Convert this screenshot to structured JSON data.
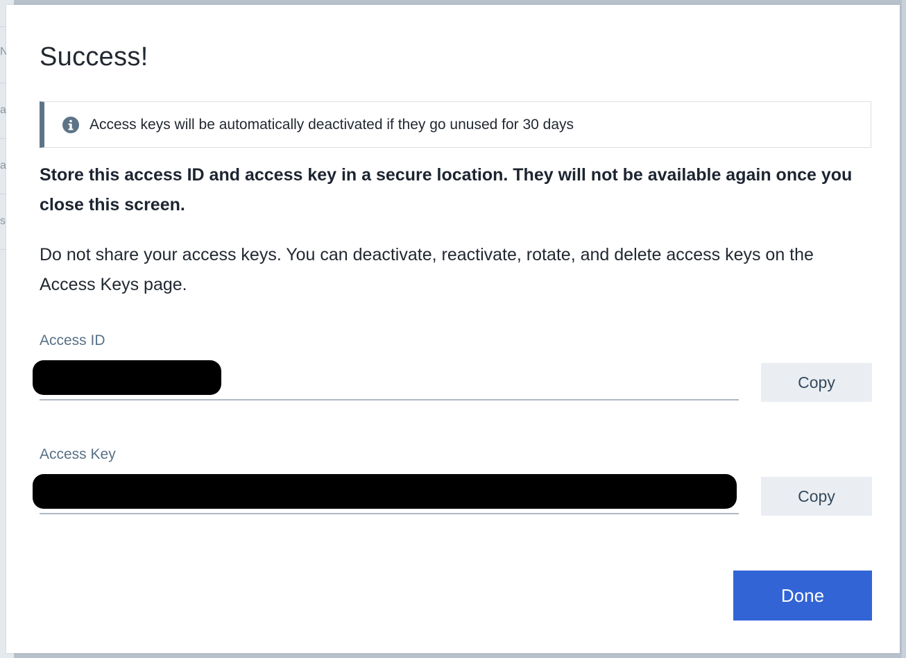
{
  "backdrop": {
    "fragments": [
      "N",
      "a",
      "a",
      "s-"
    ]
  },
  "modal": {
    "title": "Success!",
    "notice": {
      "icon": "info-icon",
      "text": "Access keys will be automatically deactivated if they go unused for 30 days"
    },
    "warning": "Store this access ID and access key in a secure location. They will not be available again once you close this screen.",
    "description": "Do not share your access keys. You can deactivate, reactivate, rotate, and delete access keys on the Access Keys page.",
    "access_id": {
      "label": "Access ID",
      "value": "",
      "redacted": true,
      "copy_label": "Copy"
    },
    "access_key": {
      "label": "Access Key",
      "value": "",
      "redacted": true,
      "copy_label": "Copy"
    },
    "done_label": "Done"
  },
  "colors": {
    "accent": "#3264d6",
    "notice_bar": "#5d7387",
    "label": "#587087",
    "copy_bg": "#eaeef2"
  }
}
